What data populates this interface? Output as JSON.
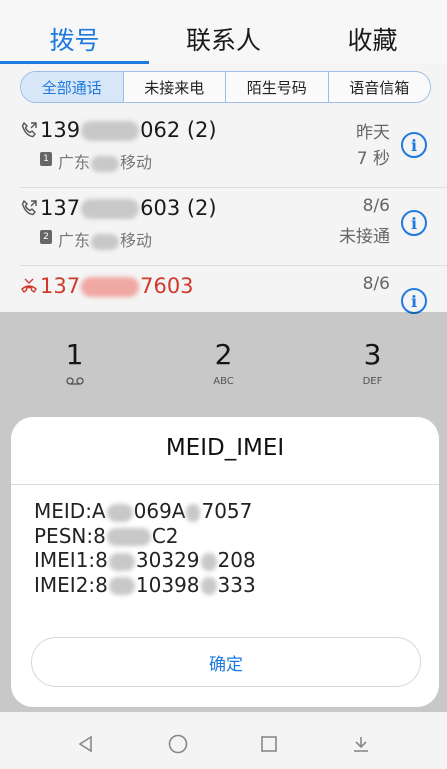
{
  "tabs": [
    {
      "label": "拨号",
      "active": true
    },
    {
      "label": "联系人",
      "active": false
    },
    {
      "label": "收藏",
      "active": false
    }
  ],
  "filters": [
    {
      "label": "全部通话",
      "active": true
    },
    {
      "label": "未接来电",
      "active": false
    },
    {
      "label": "陌生号码",
      "active": false
    },
    {
      "label": "语音信箱",
      "active": false
    }
  ],
  "calls": [
    {
      "number_prefix": "139",
      "number_suffix": "062 (2)",
      "location_prefix": "广东",
      "location_suffix": "移动",
      "sim": "1",
      "time": "昨天",
      "duration": "7 秒",
      "type": "outgoing"
    },
    {
      "number_prefix": "137",
      "number_suffix": "603 (2)",
      "location_prefix": "广东",
      "location_suffix": "移动",
      "sim": "2",
      "time": "8/6",
      "duration": "未接通",
      "type": "outgoing"
    },
    {
      "number_prefix": "137",
      "number_suffix": "7603",
      "time": "8/6",
      "type": "missed"
    }
  ],
  "dialpad": [
    {
      "digit": "1",
      "sub": "voicemail-icon"
    },
    {
      "digit": "2",
      "sub": "ABC"
    },
    {
      "digit": "3",
      "sub": "DEF"
    }
  ],
  "dialog": {
    "title": "MEID_IMEI",
    "lines": {
      "meid": {
        "prefix": "MEID:A",
        "mid": "069A",
        "suffix": "7057"
      },
      "pesn": {
        "prefix": "PESN:8",
        "suffix": "C2"
      },
      "imei1": {
        "prefix": "IMEI1:8",
        "mid": "30329",
        "suffix": "208"
      },
      "imei2": {
        "prefix": "IMEI2:8",
        "mid": "10398",
        "suffix": "333"
      }
    },
    "confirm_label": "确定"
  },
  "nav": [
    "back-icon",
    "home-icon",
    "recents-icon",
    "notification-icon"
  ],
  "colors": {
    "accent": "#1f7ae0",
    "missed": "#d0392d"
  }
}
